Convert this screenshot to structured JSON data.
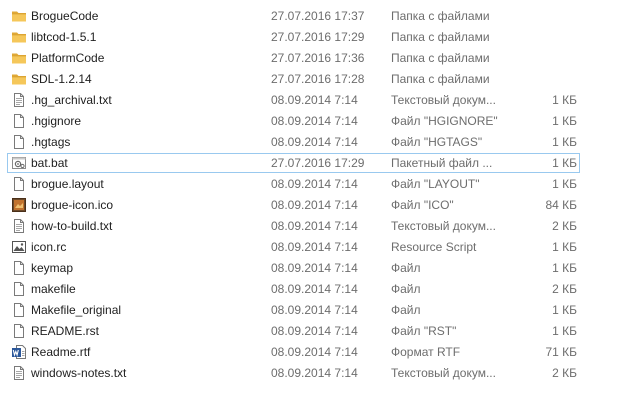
{
  "files": [
    {
      "name": "BrogueCode",
      "date": "27.07.2016 17:37",
      "type": "Папка с файлами",
      "size": "",
      "icon": "folder-icon"
    },
    {
      "name": "libtcod-1.5.1",
      "date": "27.07.2016 17:29",
      "type": "Папка с файлами",
      "size": "",
      "icon": "folder-icon"
    },
    {
      "name": "PlatformCode",
      "date": "27.07.2016 17:36",
      "type": "Папка с файлами",
      "size": "",
      "icon": "folder-icon"
    },
    {
      "name": "SDL-1.2.14",
      "date": "27.07.2016 17:28",
      "type": "Папка с файлами",
      "size": "",
      "icon": "folder-icon"
    },
    {
      "name": ".hg_archival.txt",
      "date": "08.09.2014 7:14",
      "type": "Текстовый докум...",
      "size": "1 КБ",
      "icon": "text-file-icon"
    },
    {
      "name": ".hgignore",
      "date": "08.09.2014 7:14",
      "type": "Файл \"HGIGNORE\"",
      "size": "1 КБ",
      "icon": "file-icon"
    },
    {
      "name": ".hgtags",
      "date": "08.09.2014 7:14",
      "type": "Файл \"HGTAGS\"",
      "size": "1 КБ",
      "icon": "file-icon"
    },
    {
      "name": "bat.bat",
      "date": "27.07.2016 17:29",
      "type": "Пакетный файл ...",
      "size": "1 КБ",
      "icon": "batch-file-icon"
    },
    {
      "name": "brogue.layout",
      "date": "08.09.2014 7:14",
      "type": "Файл \"LAYOUT\"",
      "size": "1 КБ",
      "icon": "file-icon"
    },
    {
      "name": "brogue-icon.ico",
      "date": "08.09.2014 7:14",
      "type": "Файл \"ICO\"",
      "size": "84 КБ",
      "icon": "ico-file-icon"
    },
    {
      "name": "how-to-build.txt",
      "date": "08.09.2014 7:14",
      "type": "Текстовый докум...",
      "size": "2 КБ",
      "icon": "text-file-icon"
    },
    {
      "name": "icon.rc",
      "date": "08.09.2014 7:14",
      "type": "Resource Script",
      "size": "1 КБ",
      "icon": "resource-script-icon"
    },
    {
      "name": "keymap",
      "date": "08.09.2014 7:14",
      "type": "Файл",
      "size": "1 КБ",
      "icon": "file-icon"
    },
    {
      "name": "makefile",
      "date": "08.09.2014 7:14",
      "type": "Файл",
      "size": "2 КБ",
      "icon": "file-icon"
    },
    {
      "name": "Makefile_original",
      "date": "08.09.2014 7:14",
      "type": "Файл",
      "size": "1 КБ",
      "icon": "file-icon"
    },
    {
      "name": "README.rst",
      "date": "08.09.2014 7:14",
      "type": "Файл \"RST\"",
      "size": "1 КБ",
      "icon": "file-icon"
    },
    {
      "name": "Readme.rtf",
      "date": "08.09.2014 7:14",
      "type": "Формат RTF",
      "size": "71 КБ",
      "icon": "word-document-icon"
    },
    {
      "name": "windows-notes.txt",
      "date": "08.09.2014 7:14",
      "type": "Текстовый докум...",
      "size": "2 КБ",
      "icon": "text-file-icon"
    }
  ],
  "selected_index": 7,
  "colors": {
    "folder": "#e8b84a",
    "folder_dark": "#d4a030",
    "selection_border": "#99c9ef",
    "word_blue": "#2b579a"
  }
}
